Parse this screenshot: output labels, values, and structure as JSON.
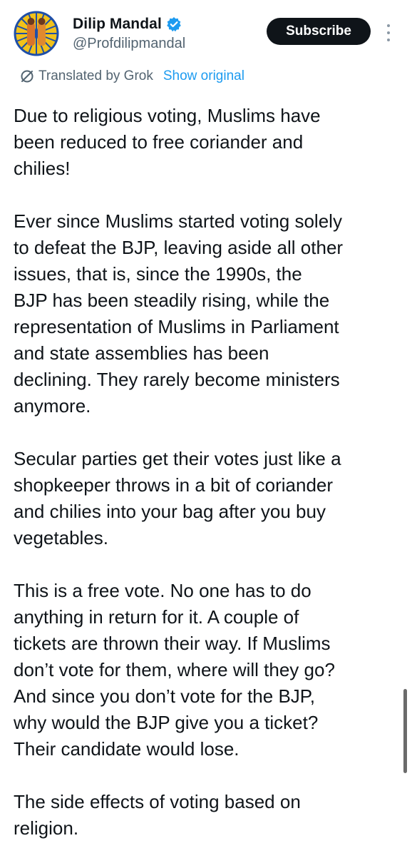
{
  "author": {
    "display_name": "Dilip Mandal",
    "handle": "@Profdilipmandal",
    "verified": true,
    "avatar_icon": "profile-photo"
  },
  "actions": {
    "subscribe_label": "Subscribe",
    "more_icon": "more-vertical-icon"
  },
  "translation": {
    "notice": "Translated by Grok",
    "show_original_label": "Show original",
    "link_color": "#1d9bf0"
  },
  "tweet": {
    "paragraphs": [
      "Due to religious voting, Muslims have\nbeen reduced to free coriander and\nchilies!",
      "Ever since Muslims started voting solely\nto defeat the BJP, leaving aside all other\nissues, that is, since the 1990s, the\nBJP has been steadily rising, while the\nrepresentation of Muslims in Parliament\nand state assemblies has been\ndeclining. They rarely become ministers\nanymore.",
      "Secular parties get their votes just like a\nshopkeeper throws in a bit of coriander\nand chilies into your bag after you buy\nvegetables.",
      "This is a free vote. No one has to do\nanything in return for it. A couple of\ntickets are thrown their way. If Muslims\ndon’t vote for them, where will they go?\nAnd since you don’t vote for the BJP,\nwhy would the BJP give you a ticket?\nTheir candidate would lose.",
      "The side effects of voting based on\nreligion."
    ]
  },
  "colors": {
    "text_primary": "#0f1419",
    "text_secondary": "#536471",
    "verified_badge": "#1d9bf0",
    "button_bg": "#0f1419"
  }
}
